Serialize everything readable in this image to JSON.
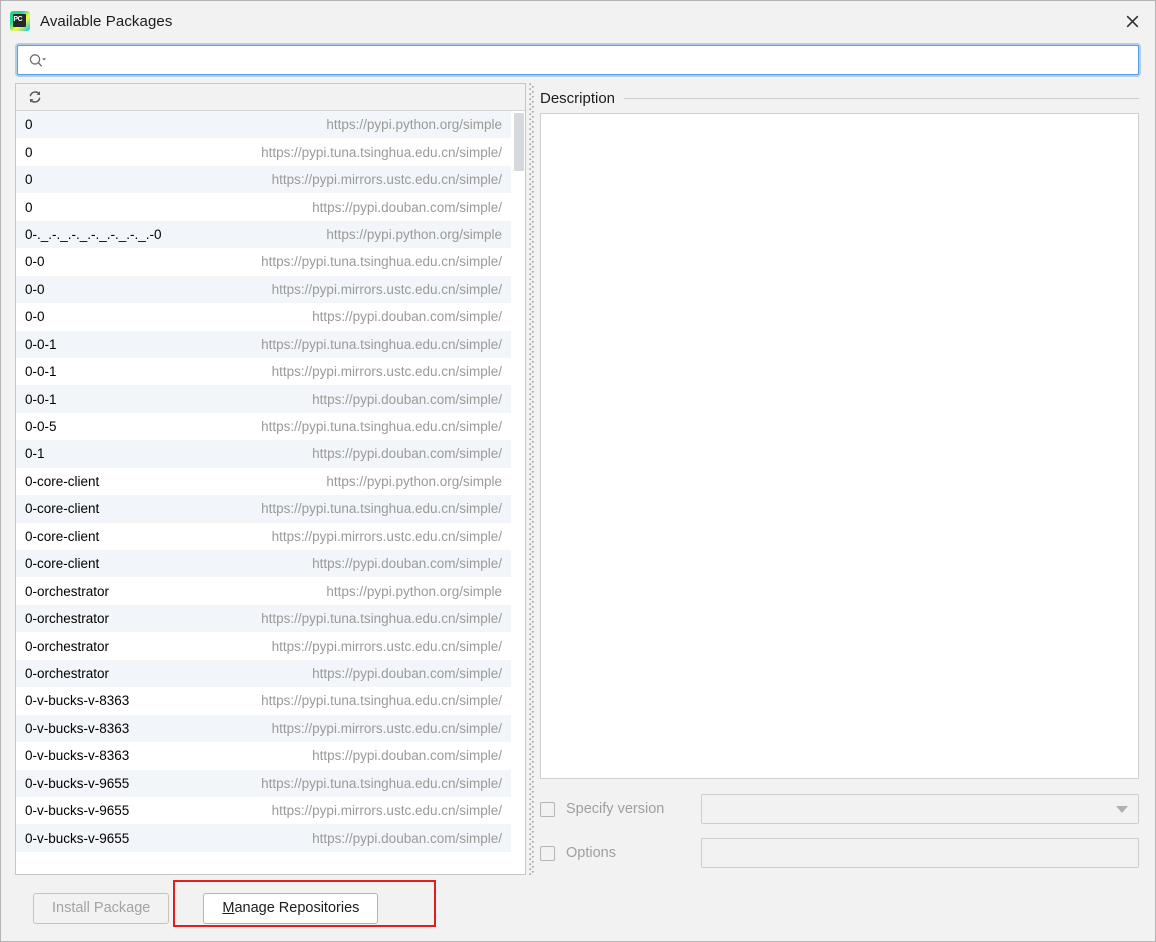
{
  "window": {
    "title": "Available Packages",
    "app_icon": "pycharm-icon",
    "icon_text": "PC",
    "close_icon": "close-icon"
  },
  "search": {
    "value": "",
    "placeholder": "",
    "icon": "search-icon"
  },
  "list_toolbar": {
    "refresh_icon": "refresh-icon"
  },
  "packages": {
    "columns": [
      "name",
      "repository"
    ],
    "rows": [
      {
        "name": "0",
        "url": "https://pypi.python.org/simple"
      },
      {
        "name": "0",
        "url": "https://pypi.tuna.tsinghua.edu.cn/simple/"
      },
      {
        "name": "0",
        "url": "https://pypi.mirrors.ustc.edu.cn/simple/"
      },
      {
        "name": "0",
        "url": "https://pypi.douban.com/simple/"
      },
      {
        "name": "0-._.-._.-._.-._.-._.-._.-0",
        "url": "https://pypi.python.org/simple"
      },
      {
        "name": "0-0",
        "url": "https://pypi.tuna.tsinghua.edu.cn/simple/"
      },
      {
        "name": "0-0",
        "url": "https://pypi.mirrors.ustc.edu.cn/simple/"
      },
      {
        "name": "0-0",
        "url": "https://pypi.douban.com/simple/"
      },
      {
        "name": "0-0-1",
        "url": "https://pypi.tuna.tsinghua.edu.cn/simple/"
      },
      {
        "name": "0-0-1",
        "url": "https://pypi.mirrors.ustc.edu.cn/simple/"
      },
      {
        "name": "0-0-1",
        "url": "https://pypi.douban.com/simple/"
      },
      {
        "name": "0-0-5",
        "url": "https://pypi.tuna.tsinghua.edu.cn/simple/"
      },
      {
        "name": "0-1",
        "url": "https://pypi.douban.com/simple/"
      },
      {
        "name": "0-core-client",
        "url": "https://pypi.python.org/simple"
      },
      {
        "name": "0-core-client",
        "url": "https://pypi.tuna.tsinghua.edu.cn/simple/"
      },
      {
        "name": "0-core-client",
        "url": "https://pypi.mirrors.ustc.edu.cn/simple/"
      },
      {
        "name": "0-core-client",
        "url": "https://pypi.douban.com/simple/"
      },
      {
        "name": "0-orchestrator",
        "url": "https://pypi.python.org/simple"
      },
      {
        "name": "0-orchestrator",
        "url": "https://pypi.tuna.tsinghua.edu.cn/simple/"
      },
      {
        "name": "0-orchestrator",
        "url": "https://pypi.mirrors.ustc.edu.cn/simple/"
      },
      {
        "name": "0-orchestrator",
        "url": "https://pypi.douban.com/simple/"
      },
      {
        "name": "0-v-bucks-v-8363",
        "url": "https://pypi.tuna.tsinghua.edu.cn/simple/"
      },
      {
        "name": "0-v-bucks-v-8363",
        "url": "https://pypi.mirrors.ustc.edu.cn/simple/"
      },
      {
        "name": "0-v-bucks-v-8363",
        "url": "https://pypi.douban.com/simple/"
      },
      {
        "name": "0-v-bucks-v-9655",
        "url": "https://pypi.tuna.tsinghua.edu.cn/simple/"
      },
      {
        "name": "0-v-bucks-v-9655",
        "url": "https://pypi.mirrors.ustc.edu.cn/simple/"
      },
      {
        "name": "0-v-bucks-v-9655",
        "url": "https://pypi.douban.com/simple/"
      }
    ]
  },
  "description": {
    "title": "Description",
    "body": ""
  },
  "options": {
    "specify_version": {
      "label": "Specify version",
      "checked": false,
      "value": "",
      "dropdown_icon": "chevron-down-icon"
    },
    "extra_options": {
      "label": "Options",
      "checked": false,
      "value": ""
    }
  },
  "footer": {
    "install_label": "Install Package",
    "manage_repos_mnemonic": "M",
    "manage_repos_label": "anage Repositories"
  },
  "colors": {
    "dialog_bg": "#f2f2f2",
    "row_alt": "#f2f5f9",
    "url_text": "#9a9a9a",
    "focus_ring": "#7ab0e8",
    "annotation": "#e02020",
    "disabled_text": "#a3a3a3"
  }
}
